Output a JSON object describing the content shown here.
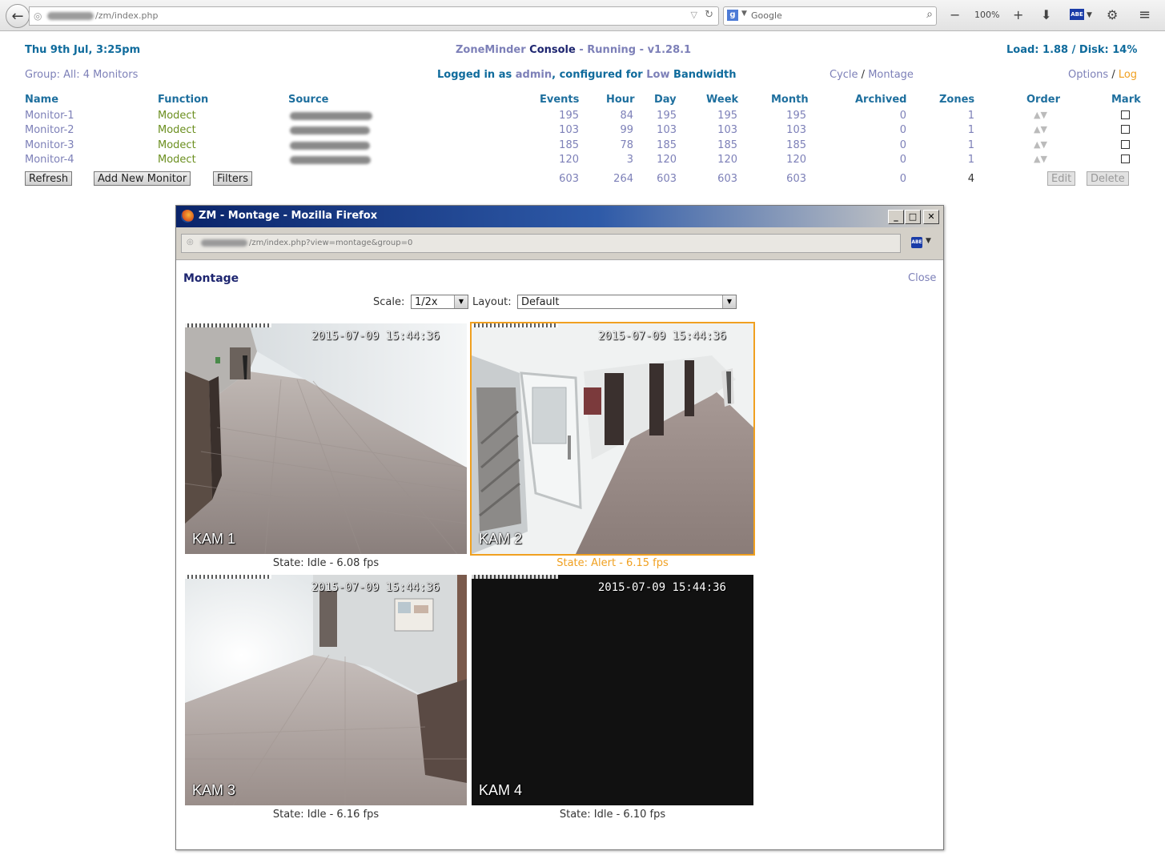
{
  "browser": {
    "url_path": "/zm/index.php",
    "search_engine": "Google",
    "zoom": "100%"
  },
  "header": {
    "datetime": "Thu 9th Jul, 3:25pm",
    "app_name": "ZoneMinder",
    "console_label": "Console",
    "sep1": "-",
    "status": "Running",
    "sep2": "-",
    "version": "v1.28.1",
    "load": "Load: 1.88",
    "disk": "Disk: 14%",
    "slash": "/"
  },
  "subheader": {
    "group_label": "Group:",
    "group_value": "All:",
    "group_count": "4 Monitors",
    "logged_in_prefix": "Logged in as",
    "user": "admin",
    "configured_for": ", configured for",
    "bandwidth": "Low",
    "bandwidth_suffix": "Bandwidth",
    "cycle": "Cycle",
    "montage": "Montage",
    "options": "Options",
    "log": "Log",
    "slash": "/"
  },
  "table": {
    "headers": {
      "name": "Name",
      "function": "Function",
      "source": "Source",
      "events": "Events",
      "hour": "Hour",
      "day": "Day",
      "week": "Week",
      "month": "Month",
      "archived": "Archived",
      "zones": "Zones",
      "order": "Order",
      "mark": "Mark"
    },
    "rows": [
      {
        "name": "Monitor-1",
        "function": "Modect",
        "events": "195",
        "hour": "84",
        "day": "195",
        "week": "195",
        "month": "195",
        "archived": "0",
        "zones": "1"
      },
      {
        "name": "Monitor-2",
        "function": "Modect",
        "events": "103",
        "hour": "99",
        "day": "103",
        "week": "103",
        "month": "103",
        "archived": "0",
        "zones": "1"
      },
      {
        "name": "Monitor-3",
        "function": "Modect",
        "events": "185",
        "hour": "78",
        "day": "185",
        "week": "185",
        "month": "185",
        "archived": "0",
        "zones": "1"
      },
      {
        "name": "Monitor-4",
        "function": "Modect",
        "events": "120",
        "hour": "3",
        "day": "120",
        "week": "120",
        "month": "120",
        "archived": "0",
        "zones": "1"
      }
    ],
    "totals": {
      "events": "603",
      "hour": "264",
      "day": "603",
      "week": "603",
      "month": "603",
      "archived": "0",
      "zones": "4"
    },
    "order_arrows": "▲▼"
  },
  "buttons": {
    "refresh": "Refresh",
    "add_monitor": "Add New Monitor",
    "filters": "Filters",
    "edit": "Edit",
    "delete": "Delete"
  },
  "popup": {
    "window_title": "ZM - Montage - Mozilla Firefox",
    "url_path": "/zm/index.php?view=montage&group=0",
    "heading": "Montage",
    "close": "Close",
    "scale_label": "Scale:",
    "scale_value": "1/2x",
    "layout_label": "Layout:",
    "layout_value": "Default",
    "timestamp": "2015-07-09 15:44:36",
    "cameras": [
      {
        "label": "KAM 1",
        "state": "State: Idle - 6.08 fps"
      },
      {
        "label": "KAM 2",
        "state": "State: Alert - 6.15 fps"
      },
      {
        "label": "KAM 3",
        "state": "State: Idle - 6.16 fps"
      },
      {
        "label": "KAM 4",
        "state": "State: Idle - 6.10 fps"
      }
    ]
  },
  "colors": {
    "link_lavender": "#7d80b8",
    "header_blue": "#0f6b9c",
    "function_green": "#6b8f1f",
    "alert_orange": "#f0a020",
    "title_navy": "#1e2670"
  }
}
